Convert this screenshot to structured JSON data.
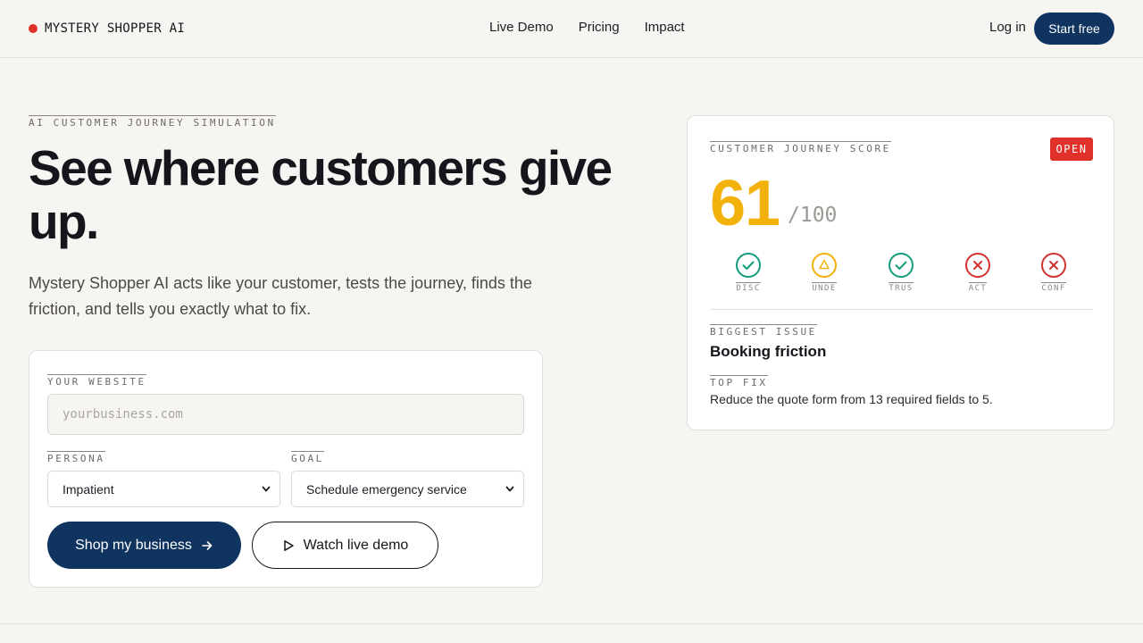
{
  "header": {
    "brand": "MYSTERY SHOPPER AI",
    "nav": [
      "Live Demo",
      "Pricing",
      "Impact"
    ],
    "login": "Log in",
    "start": "Start free",
    "brand_color": "#e0312b"
  },
  "hero": {
    "eyebrow": "AI CUSTOMER JOURNEY SIMULATION",
    "title": "See where customers give up.",
    "subtitle": "Mystery Shopper AI acts like your customer, tests the journey, finds the friction, and tells you exactly what to fix."
  },
  "form": {
    "website_label": "YOUR WEBSITE",
    "website_placeholder": "yourbusiness.com",
    "persona_label": "PERSONA",
    "persona_value": "Impatient",
    "goal_label": "GOAL",
    "goal_value": "Schedule emergency service",
    "shop_button": "Shop my business",
    "demo_button": "Watch live demo",
    "accent": "#0f3460"
  },
  "score": {
    "label": "CUSTOMER JOURNEY SCORE",
    "badge": "OPEN",
    "value": "61",
    "denominator": "/100",
    "value_color": "#f3b20b",
    "stages": [
      {
        "label": "DISC",
        "status": "pass",
        "icon": "check-circle-icon",
        "color": "#149c7c"
      },
      {
        "label": "UNDE",
        "status": "warn",
        "icon": "warning-circle-icon",
        "color": "#f3b20b"
      },
      {
        "label": "TRUS",
        "status": "pass",
        "icon": "check-circle-icon",
        "color": "#149c7c"
      },
      {
        "label": "ACT",
        "status": "fail",
        "icon": "x-circle-icon",
        "color": "#d2322d"
      },
      {
        "label": "CONF",
        "status": "fail",
        "icon": "x-circle-icon",
        "color": "#d2322d"
      }
    ],
    "issue_label": "BIGGEST ISSUE",
    "issue": "Booking friction",
    "fix_label": "TOP FIX",
    "fix": "Reduce the quote form from 13 required fields to 5."
  }
}
